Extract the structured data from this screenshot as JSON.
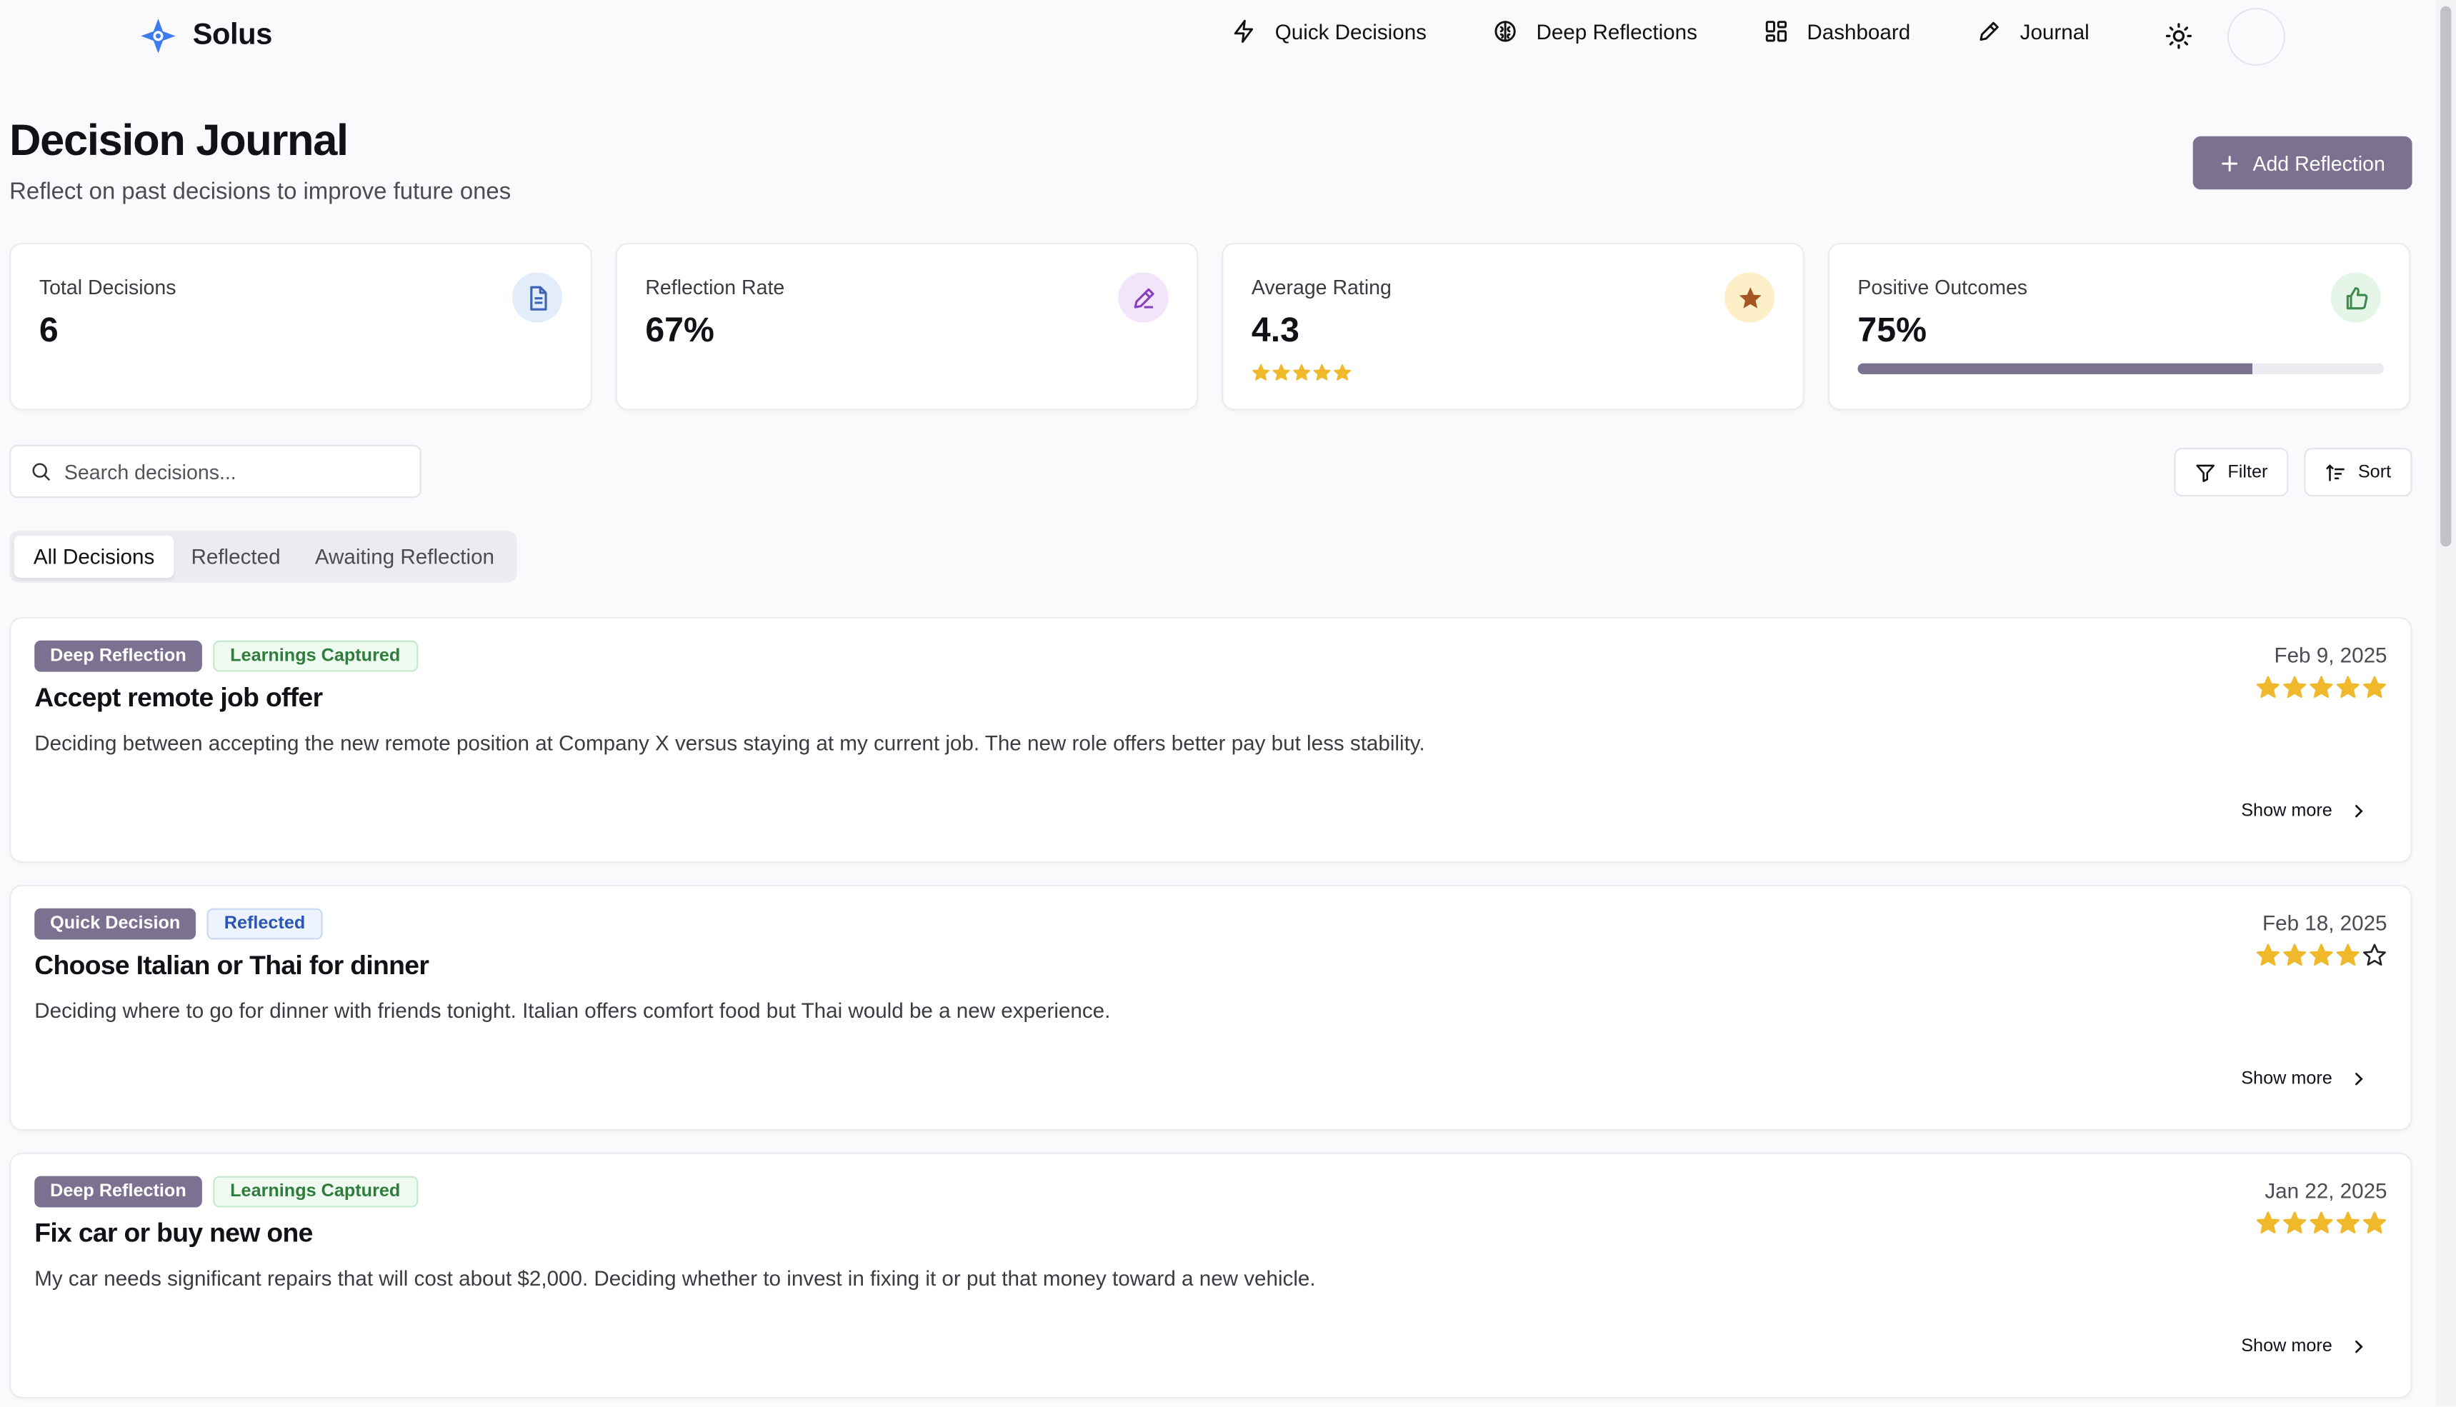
{
  "app": {
    "name": "Solus"
  },
  "nav": {
    "items": [
      {
        "label": "Quick Decisions",
        "icon": "bolt-icon"
      },
      {
        "label": "Deep Reflections",
        "icon": "brain-icon"
      },
      {
        "label": "Dashboard",
        "icon": "grid-icon"
      },
      {
        "label": "Journal",
        "icon": "pen-icon"
      }
    ],
    "theme_icon": "sun-icon"
  },
  "page": {
    "title": "Decision Journal",
    "subtitle": "Reflect on past decisions to improve future ones",
    "add_button": "Add Reflection"
  },
  "stats": [
    {
      "label": "Total Decisions",
      "value": "6",
      "icon": "document-icon",
      "icon_bg": "#e3ecfb",
      "icon_color": "#3d64b4"
    },
    {
      "label": "Reflection Rate",
      "value": "67%",
      "icon": "pen-icon",
      "icon_bg": "#f1e4fb",
      "icon_color": "#8a3fbe"
    },
    {
      "label": "Average Rating",
      "value": "4.3",
      "icon": "star-icon",
      "icon_bg": "#fdf0c9",
      "icon_color": "#a65622",
      "stars": 5
    },
    {
      "label": "Positive Outcomes",
      "value": "75%",
      "icon": "thumbs-up-icon",
      "icon_bg": "#e5f6e8",
      "icon_color": "#3f8a4d",
      "progress": 0.75
    }
  ],
  "search": {
    "placeholder": "Search decisions..."
  },
  "toolbar": {
    "filter": "Filter",
    "sort": "Sort"
  },
  "tabs": [
    "All Decisions",
    "Reflected",
    "Awaiting Reflection"
  ],
  "colors": {
    "accent": "#7b7190",
    "star": "#f0b92c",
    "logo": "#3d7cf0"
  },
  "decisions": [
    {
      "type": "Deep Reflection",
      "status": "Learnings Captured",
      "title": "Accept remote job offer",
      "description": "Deciding between accepting the new remote position at Company X versus staying at my current job. The new role offers better pay but less stability.",
      "date": "Feb 9, 2025",
      "rating": 5,
      "show_more": "Show more"
    },
    {
      "type": "Quick Decision",
      "status": "Reflected",
      "title": "Choose Italian or Thai for dinner",
      "description": "Deciding where to go for dinner with friends tonight. Italian offers comfort food but Thai would be a new experience.",
      "date": "Feb 18, 2025",
      "rating": 4,
      "show_more": "Show more"
    },
    {
      "type": "Deep Reflection",
      "status": "Learnings Captured",
      "title": "Fix car or buy new one",
      "description": "My car needs significant repairs that will cost about $2,000. Deciding whether to invest in fixing it or put that money toward a new vehicle.",
      "date": "Jan 22, 2025",
      "rating": 5,
      "show_more": "Show more"
    }
  ]
}
